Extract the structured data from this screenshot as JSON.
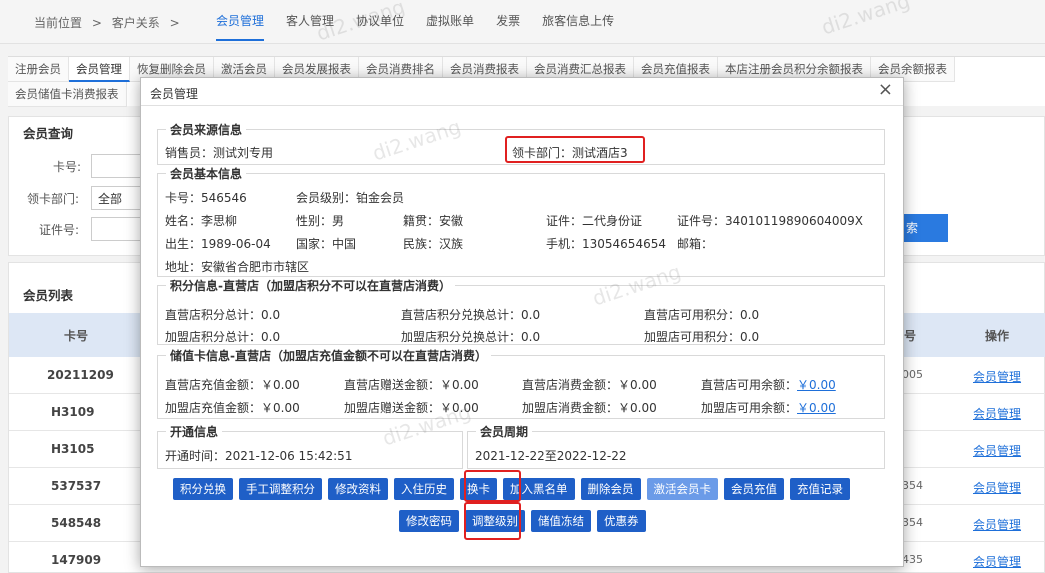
{
  "breadcrumb": {
    "prefix": "当前位置",
    "sep": ">",
    "section": "客户关系",
    "sep2": ">"
  },
  "topnav": [
    "会员管理",
    "客人管理",
    "协议单位",
    "虚拟账单",
    "发票",
    "旅客信息上传"
  ],
  "tabs_row1": [
    "注册会员",
    "会员管理",
    "恢复删除会员",
    "激活会员",
    "会员发展报表",
    "会员消费排名",
    "会员消费报表",
    "会员消费汇总报表",
    "会员充值报表",
    "本店注册会员积分余额报表",
    "会员余额报表"
  ],
  "tabs_row2": [
    "会员储值卡消费报表"
  ],
  "query": {
    "title": "会员查询",
    "card_label": "卡号:",
    "dept_label": "领卡部门:",
    "dept_value": "全部",
    "id_label": "证件号:",
    "search_btn": "索"
  },
  "list": {
    "title": "会员列表",
    "col_card": "卡号",
    "col_tail": "号",
    "col_op": "操作",
    "rows": [
      {
        "card": "20211209",
        "suffix": "005",
        "op": "会员管理"
      },
      {
        "card": "H3109",
        "suffix": "",
        "op": "会员管理"
      },
      {
        "card": "H3105",
        "suffix": "",
        "op": "会员管理"
      },
      {
        "card": "537537",
        "suffix": "354",
        "op": "会员管理"
      },
      {
        "card": "548548",
        "suffix": "354",
        "op": "会员管理"
      },
      {
        "card": "147909",
        "suffix": "435",
        "op": "会员管理"
      }
    ]
  },
  "modal": {
    "title": "会员管理",
    "close": "×",
    "source": {
      "legend": "会员来源信息",
      "seller": "销售员：测试刘专用",
      "dept": "领卡部门：测试酒店3"
    },
    "basic": {
      "legend": "会员基本信息",
      "card": "卡号：546546",
      "level": "会员级别：铂金会员",
      "name": "姓名：李思柳",
      "sex": "性别：男",
      "origin": "籍贯：安徽",
      "idtype": "证件：二代身份证",
      "idno": "证件号：34010119890604009X",
      "birth": "出生：1989-06-04",
      "country": "国家：中国",
      "nation": "民族：汉族",
      "phone": "手机：13054654654",
      "email": "邮箱：",
      "address": "地址：安徽省合肥市市辖区"
    },
    "points": {
      "legend": "积分信息-直营店（加盟店积分不可以在直营店消费）",
      "d_total": "直营店积分总计：0.0",
      "d_exch": "直营店积分兑换总计：0.0",
      "d_avail": "直营店可用积分：0.0",
      "j_total": "加盟店积分总计：0.0",
      "j_exch": "加盟店积分兑换总计：0.0",
      "j_avail": "加盟店可用积分：0.0"
    },
    "stored": {
      "legend": "储值卡信息-直营店（加盟店充值金额不可以在直营店消费）",
      "d_charge": "直营店充值金额：￥0.00",
      "d_gift": "直营店赠送金额：￥0.00",
      "d_consume": "直营店消费金额：￥0.00",
      "d_avail_label": "直营店可用余额：",
      "d_avail_val": "￥0.00",
      "j_charge": "加盟店充值金额：￥0.00",
      "j_gift": "加盟店赠送金额：￥0.00",
      "j_consume": "加盟店消费金额：￥0.00",
      "j_avail_label": "加盟店可用余额：",
      "j_avail_val": "￥0.00"
    },
    "open": {
      "legend": "开通信息",
      "time": "开通时间：2021-12-06 15:42:51"
    },
    "period": {
      "legend": "会员周期",
      "range": "2021-12-22至2022-12-22"
    },
    "buttons_row1": [
      "积分兑换",
      "手工调整积分",
      "修改资料",
      "入住历史",
      "换卡",
      "加入黑名单",
      "删除会员",
      "激活会员卡",
      "会员充值",
      "充值记录"
    ],
    "buttons_row2": [
      "修改密码",
      "调整级别",
      "储值冻结",
      "优惠券"
    ]
  },
  "watermark": "di2.wang",
  "colors": {
    "accent": "#1e6fd9",
    "button": "#1f5fc7",
    "highlight": "#e02020"
  }
}
